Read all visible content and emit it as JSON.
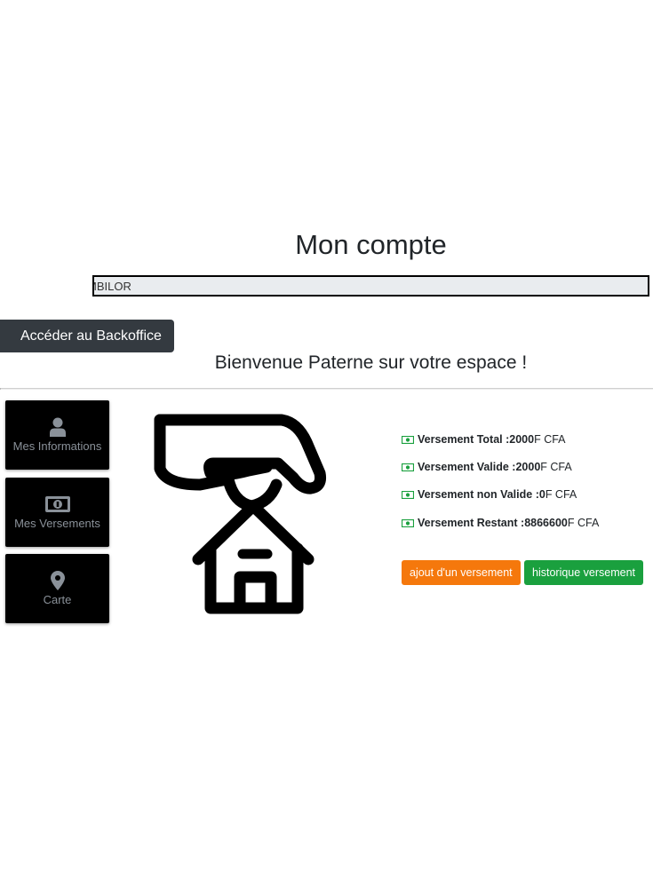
{
  "page": {
    "title": "Mon compte"
  },
  "marquee": {
    "text": "MBILOR"
  },
  "backoffice_button": {
    "label": "Accéder au Backoffice"
  },
  "welcome": {
    "text": "Bienvenue Paterne sur votre espace !"
  },
  "menu": [
    {
      "label": "Mes Informations",
      "icon": "user-icon"
    },
    {
      "label": "Mes Versements",
      "icon": "money-icon"
    },
    {
      "label": "Carte",
      "icon": "map-marker-icon"
    }
  ],
  "illustration": {
    "icon": "hand-house-icon"
  },
  "stats": [
    {
      "label": "Versement Total : ",
      "value": "2000",
      "unit": " F CFA",
      "icon": "money-icon"
    },
    {
      "label": "Versement Valide : ",
      "value": "2000",
      "unit": " F CFA",
      "icon": "money-icon"
    },
    {
      "label": "Versement non Valide : ",
      "value": "0",
      "unit": " F CFA",
      "icon": "money-icon"
    },
    {
      "label": "Versement Restant : ",
      "value": "8866600",
      "unit": " F CFA",
      "icon": "money-icon"
    }
  ],
  "actions": {
    "add_label": "ajout d'un versement",
    "history_label": "historique versement"
  },
  "colors": {
    "dark_button": "#343a40",
    "tile_bg": "#000000",
    "money_icon": "#1aa03e",
    "orange": "#f5780c",
    "green": "#1aa03e"
  }
}
